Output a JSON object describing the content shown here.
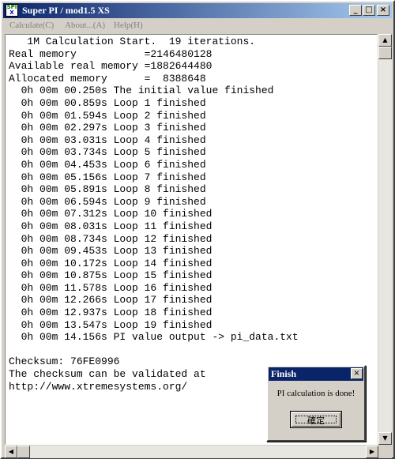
{
  "window": {
    "title": "Super PI / mod1.5 XS",
    "icon_text_top": "SPI",
    "icon_text_bottom": "X",
    "minimize_glyph": "_",
    "maximize_glyph": "□",
    "close_glyph": "×"
  },
  "menu": {
    "items": [
      {
        "label": "Calculate(C)"
      },
      {
        "label": "About...(A)"
      },
      {
        "label": "Help(H)"
      }
    ]
  },
  "log": {
    "lines": [
      "   1M Calculation Start.  19 iterations.",
      "Real memory           =2146480128",
      "Available real memory =1882644480",
      "Allocated memory      =  8388648",
      "  0h 00m 00.250s The initial value finished",
      "  0h 00m 00.859s Loop 1 finished",
      "  0h 00m 01.594s Loop 2 finished",
      "  0h 00m 02.297s Loop 3 finished",
      "  0h 00m 03.031s Loop 4 finished",
      "  0h 00m 03.734s Loop 5 finished",
      "  0h 00m 04.453s Loop 6 finished",
      "  0h 00m 05.156s Loop 7 finished",
      "  0h 00m 05.891s Loop 8 finished",
      "  0h 00m 06.594s Loop 9 finished",
      "  0h 00m 07.312s Loop 10 finished",
      "  0h 00m 08.031s Loop 11 finished",
      "  0h 00m 08.734s Loop 12 finished",
      "  0h 00m 09.453s Loop 13 finished",
      "  0h 00m 10.172s Loop 14 finished",
      "  0h 00m 10.875s Loop 15 finished",
      "  0h 00m 11.578s Loop 16 finished",
      "  0h 00m 12.266s Loop 17 finished",
      "  0h 00m 12.937s Loop 18 finished",
      "  0h 00m 13.547s Loop 19 finished",
      "  0h 00m 14.156s PI value output -> pi_data.txt",
      "",
      "Checksum: 76FE0996",
      "The checksum can be validated at",
      "http://www.xtremesystems.org/"
    ]
  },
  "dialog": {
    "title": "Finish",
    "message": "PI calculation is done!",
    "ok_label": "確定",
    "close_glyph": "×"
  },
  "scrollbars": {
    "up_glyph": "▲",
    "down_glyph": "▼",
    "left_glyph": "◀",
    "right_glyph": "▶"
  }
}
